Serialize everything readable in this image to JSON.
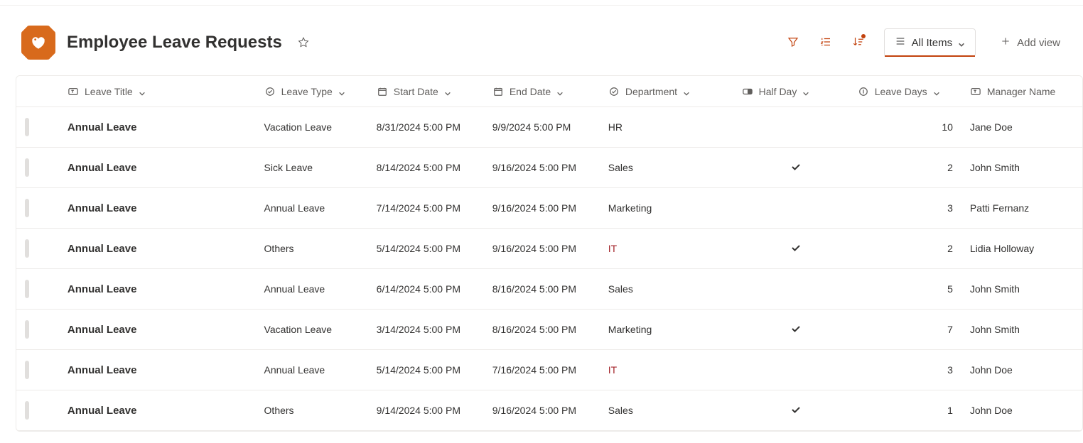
{
  "header": {
    "title": "Employee Leave Requests"
  },
  "toolbar": {
    "view_label": "All Items",
    "add_view_label": "Add view"
  },
  "columns": {
    "title": "Leave Title",
    "type": "Leave Type",
    "start": "Start Date",
    "end": "End Date",
    "dept": "Department",
    "half": "Half Day",
    "days": "Leave Days",
    "mgr": "Manager Name"
  },
  "accentDepts": [
    "IT"
  ],
  "rows": [
    {
      "title": "Annual Leave",
      "type": "Vacation Leave",
      "start": "8/31/2024 5:00 PM",
      "end": "9/9/2024 5:00 PM",
      "dept": "HR",
      "half": false,
      "days": "10",
      "mgr": "Jane Doe"
    },
    {
      "title": "Annual Leave",
      "type": "Sick Leave",
      "start": "8/14/2024 5:00 PM",
      "end": "9/16/2024 5:00 PM",
      "dept": "Sales",
      "half": true,
      "days": "2",
      "mgr": "John Smith"
    },
    {
      "title": "Annual Leave",
      "type": "Annual Leave",
      "start": "7/14/2024 5:00 PM",
      "end": "9/16/2024 5:00 PM",
      "dept": "Marketing",
      "half": false,
      "days": "3",
      "mgr": "Patti Fernanz"
    },
    {
      "title": "Annual Leave",
      "type": "Others",
      "start": "5/14/2024 5:00 PM",
      "end": "9/16/2024 5:00 PM",
      "dept": "IT",
      "half": true,
      "days": "2",
      "mgr": "Lidia Holloway"
    },
    {
      "title": "Annual Leave",
      "type": "Annual Leave",
      "start": "6/14/2024 5:00 PM",
      "end": "8/16/2024 5:00 PM",
      "dept": "Sales",
      "half": false,
      "days": "5",
      "mgr": "John Smith"
    },
    {
      "title": "Annual Leave",
      "type": "Vacation Leave",
      "start": "3/14/2024 5:00 PM",
      "end": "8/16/2024 5:00 PM",
      "dept": "Marketing",
      "half": true,
      "days": "7",
      "mgr": "John Smith"
    },
    {
      "title": "Annual Leave",
      "type": "Annual Leave",
      "start": "5/14/2024 5:00 PM",
      "end": "7/16/2024 5:00 PM",
      "dept": "IT",
      "half": false,
      "days": "3",
      "mgr": "John Doe"
    },
    {
      "title": "Annual Leave",
      "type": "Others",
      "start": "9/14/2024 5:00 PM",
      "end": "9/16/2024 5:00 PM",
      "dept": "Sales",
      "half": true,
      "days": "1",
      "mgr": "John Doe"
    }
  ]
}
